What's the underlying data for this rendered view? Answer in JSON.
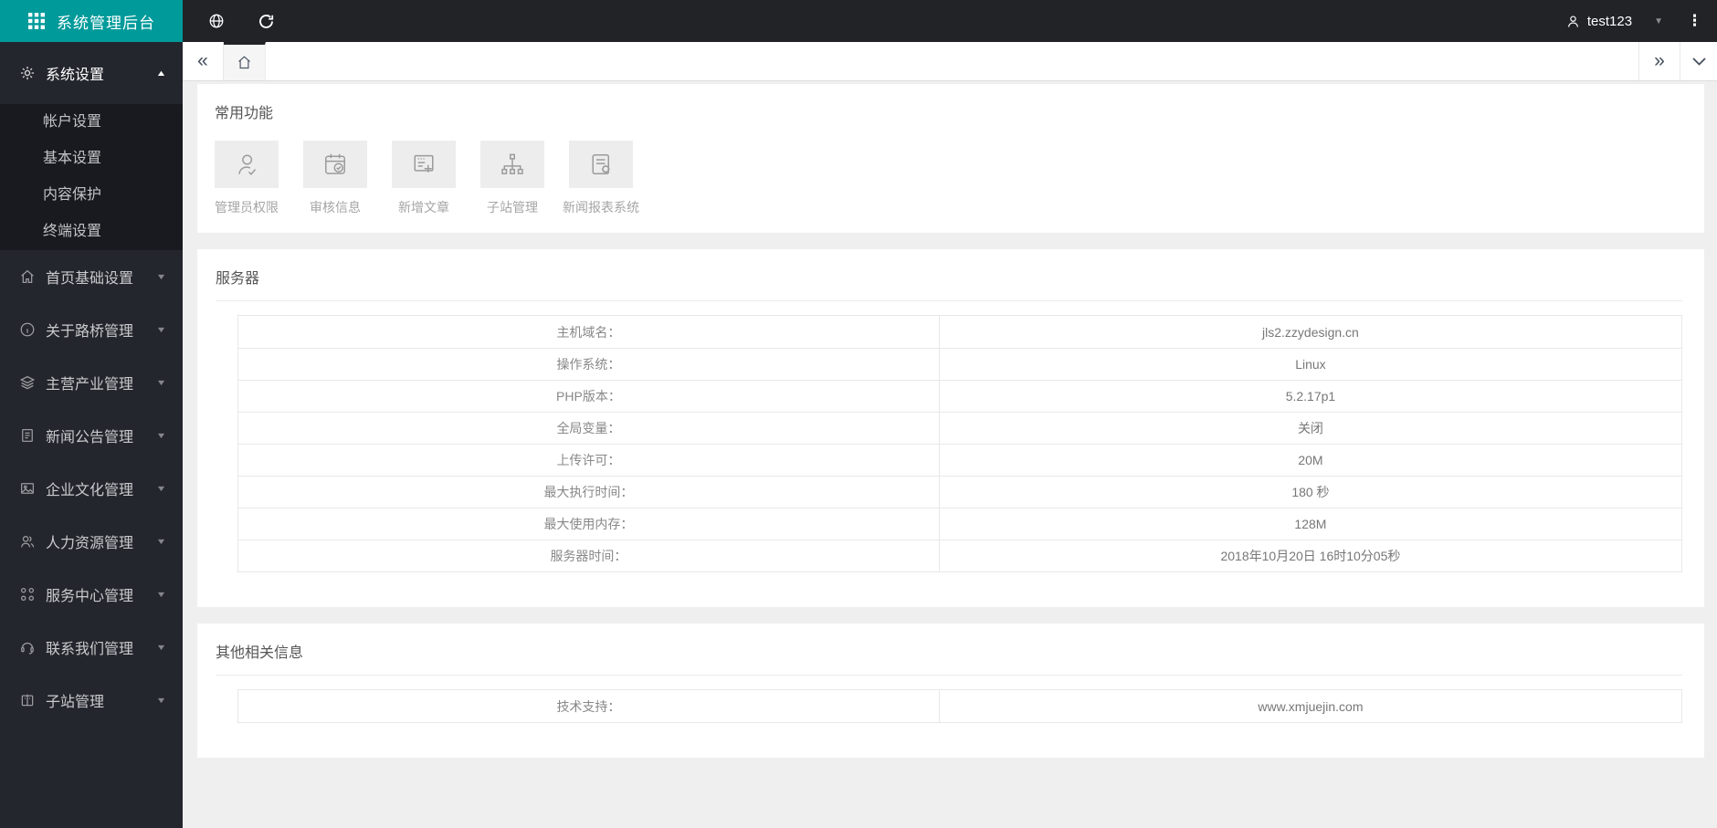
{
  "brand": {
    "title": "系统管理后台",
    "accent_color": "#009a9a"
  },
  "topbar": {
    "user": "test123",
    "icons": [
      "grid-icon",
      "globe-icon",
      "refresh-icon",
      "user-icon",
      "caret-down-icon",
      "kebab-menu-icon"
    ]
  },
  "sidebar": {
    "expanded_item": {
      "label": "系统设置",
      "icon": "gear-icon",
      "children": [
        "帐户设置",
        "基本设置",
        "内容保护",
        "终端设置"
      ]
    },
    "items": [
      {
        "label": "首页基础设置",
        "icon": "home-icon"
      },
      {
        "label": "关于路桥管理",
        "icon": "info-icon"
      },
      {
        "label": "主营产业管理",
        "icon": "layers-icon"
      },
      {
        "label": "新闻公告管理",
        "icon": "file-text-icon"
      },
      {
        "label": "企业文化管理",
        "icon": "image-icon"
      },
      {
        "label": "人力资源管理",
        "icon": "users-icon"
      },
      {
        "label": "服务中心管理",
        "icon": "command-icon"
      },
      {
        "label": "联系我们管理",
        "icon": "headset-icon"
      },
      {
        "label": "子站管理",
        "icon": "building-icon"
      }
    ]
  },
  "tabbar": {
    "home_tab_icon": "home-icon"
  },
  "quick": {
    "title": "常用功能",
    "items": [
      {
        "label": "管理员权限",
        "icon": "user-check-icon"
      },
      {
        "label": "审核信息",
        "icon": "calendar-check-icon"
      },
      {
        "label": "新增文章",
        "icon": "file-plus-icon"
      },
      {
        "label": "子站管理",
        "icon": "sitemap-icon"
      },
      {
        "label": "新闻报表系统",
        "icon": "file-gear-icon"
      }
    ]
  },
  "server": {
    "title": "服务器",
    "rows": [
      {
        "label": "主机域名：",
        "value": "jls2.zzydesign.cn"
      },
      {
        "label": "操作系统：",
        "value": "Linux"
      },
      {
        "label": "PHP版本：",
        "value": "5.2.17p1"
      },
      {
        "label": "全局变量：",
        "value": "关闭"
      },
      {
        "label": "上传许可：",
        "value": "20M"
      },
      {
        "label": "最大执行时间：",
        "value": "180 秒"
      },
      {
        "label": "最大使用内存：",
        "value": "128M"
      },
      {
        "label": "服务器时间：",
        "value": "2018年10月20日 16时10分05秒"
      }
    ]
  },
  "other": {
    "title": "其他相关信息",
    "rows": [
      {
        "label": "技术支持：",
        "value": "www.xmjuejin.com"
      }
    ]
  }
}
